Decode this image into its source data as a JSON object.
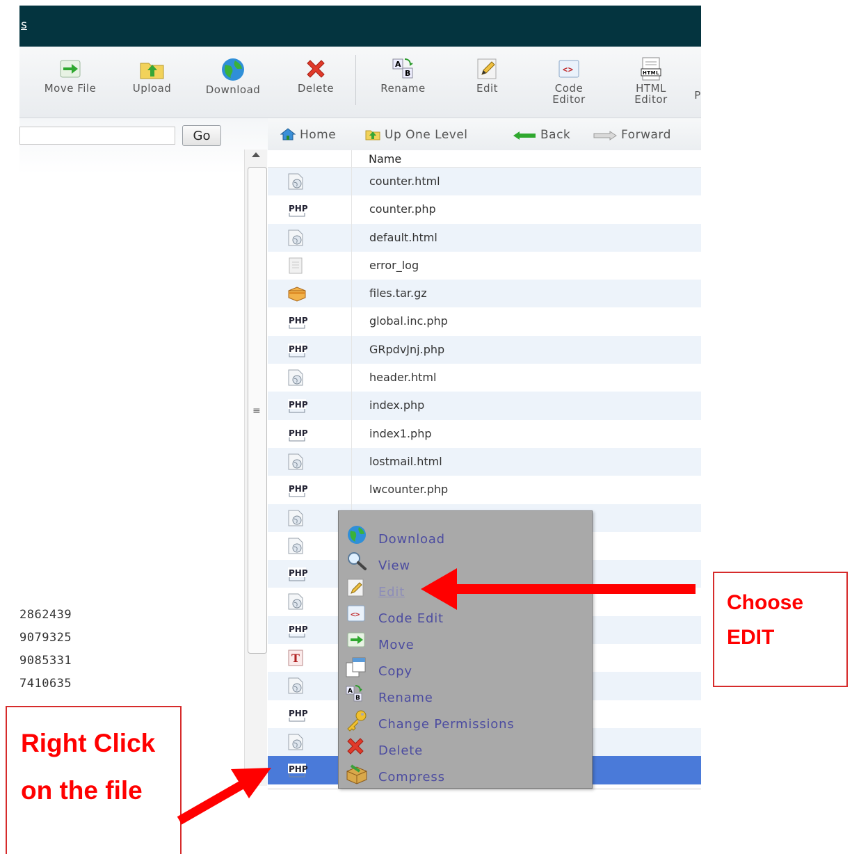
{
  "topbar": {
    "crumb": "s"
  },
  "toolbar": {
    "move_file": "Move File",
    "upload": "Upload",
    "download": "Download",
    "delete": "Delete",
    "rename": "Rename",
    "edit": "Edit",
    "code_editor_1": "Code",
    "code_editor_2": "Editor",
    "html_editor_1": "HTML",
    "html_editor_2": "Editor",
    "cut_label": "P"
  },
  "search": {
    "button": "Go",
    "value": ""
  },
  "nav": {
    "home": "Home",
    "up": "Up One Level",
    "back": "Back",
    "forward": "Forward"
  },
  "table": {
    "header_name": "Name",
    "rows": [
      {
        "name": "counter.html",
        "icon": "html-file-icon"
      },
      {
        "name": "counter.php",
        "icon": "php-file-icon"
      },
      {
        "name": "default.html",
        "icon": "html-file-icon"
      },
      {
        "name": "error_log",
        "icon": "text-file-icon"
      },
      {
        "name": "files.tar.gz",
        "icon": "archive-file-icon"
      },
      {
        "name": "global.inc.php",
        "icon": "php-file-icon"
      },
      {
        "name": "GRpdvJnj.php",
        "icon": "php-file-icon"
      },
      {
        "name": "header.html",
        "icon": "html-file-icon"
      },
      {
        "name": "index.php",
        "icon": "php-file-icon"
      },
      {
        "name": "index1.php",
        "icon": "php-file-icon"
      },
      {
        "name": "lostmail.html",
        "icon": "html-file-icon"
      },
      {
        "name": "lwcounter.php",
        "icon": "php-file-icon"
      }
    ]
  },
  "left_numbers": [
    "2862439",
    "9079325",
    "9085331",
    "7410635"
  ],
  "context_menu": {
    "download": "Download",
    "view": "View",
    "edit": "Edit",
    "code_edit": "Code Edit",
    "move": "Move",
    "copy": "Copy",
    "rename": "Rename",
    "change_permissions": "Change Permissions",
    "delete": "Delete",
    "compress": "Compress"
  },
  "callouts": {
    "choose_1": "Choose",
    "choose_2": "EDIT",
    "right_click_1": "Right Click",
    "right_click_2": "on the file"
  },
  "colors": {
    "topbar": "#04343f",
    "selected_row": "#4a7ad9",
    "menu_bg": "#a9a9a9",
    "callout_red": "#ff0000"
  }
}
